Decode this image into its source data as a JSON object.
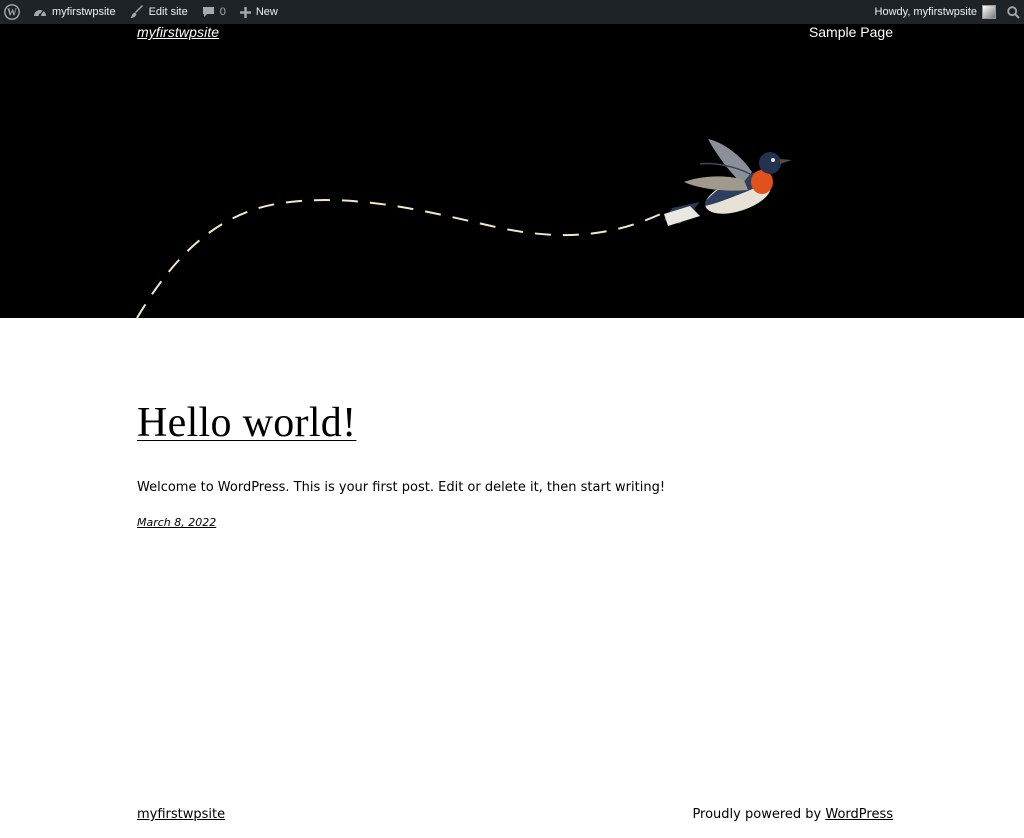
{
  "admin_bar": {
    "wp_logo_icon": "wordpress-icon",
    "site_name": "myfirstwpsite",
    "edit_site": "Edit site",
    "comments_count": "0",
    "new_label": "New",
    "howdy": "Howdy, myfirstwpsite"
  },
  "header": {
    "site_title": "myfirstwpsite",
    "nav": [
      "Sample Page"
    ]
  },
  "post": {
    "title": "Hello world!",
    "excerpt": "Welcome to WordPress. This is your first post. Edit or delete it, then start writing!",
    "date": "March 8, 2022"
  },
  "footer": {
    "site_title": "myfirstwpsite",
    "powered_prefix": "Proudly powered by ",
    "powered_link": "WordPress"
  },
  "colors": {
    "admin_bar_bg": "#1d2327",
    "header_bg": "#000000",
    "page_bg": "#ffffff",
    "dashed_path": "#f4e7c7"
  }
}
